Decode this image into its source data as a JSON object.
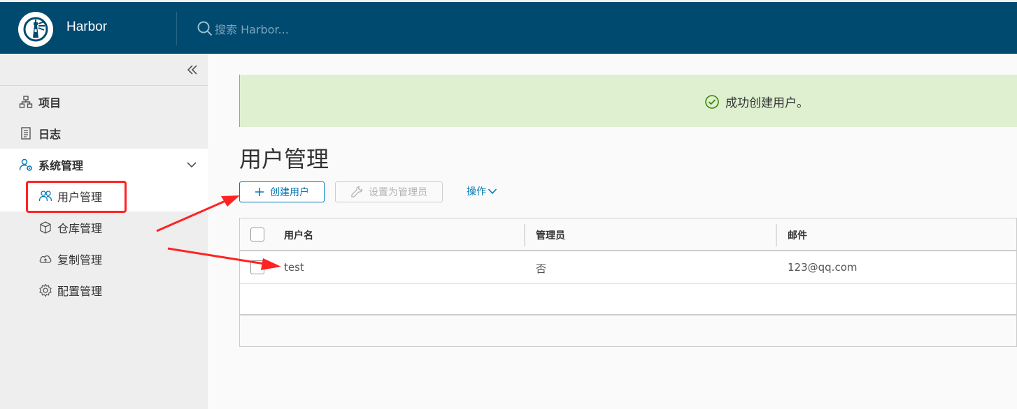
{
  "header": {
    "app_title": "Harbor",
    "search_placeholder": "搜索 Harbor..."
  },
  "sidebar": {
    "items": [
      {
        "label": "项目",
        "icon": "projects-icon"
      },
      {
        "label": "日志",
        "icon": "logs-icon"
      },
      {
        "label": "系统管理",
        "icon": "admin-icon"
      }
    ],
    "sub_items": [
      {
        "label": "用户管理",
        "icon": "users-icon"
      },
      {
        "label": "仓库管理",
        "icon": "registry-icon"
      },
      {
        "label": "复制管理",
        "icon": "replication-icon"
      },
      {
        "label": "配置管理",
        "icon": "settings-icon"
      }
    ]
  },
  "alert": {
    "message": "成功创建用户。",
    "color": "#dff0d0"
  },
  "page": {
    "title": "用户管理"
  },
  "toolbar": {
    "create_label": "创建用户",
    "set_admin_label": "设置为管理员",
    "actions_label": "操作"
  },
  "table": {
    "columns": [
      "用户名",
      "管理员",
      "邮件"
    ],
    "rows": [
      {
        "username": "test",
        "admin": "否",
        "email": "123@qq.com"
      }
    ]
  },
  "colors": {
    "header_bg": "#004a70",
    "accent": "#0079b8",
    "annotation": "#ff2222"
  }
}
